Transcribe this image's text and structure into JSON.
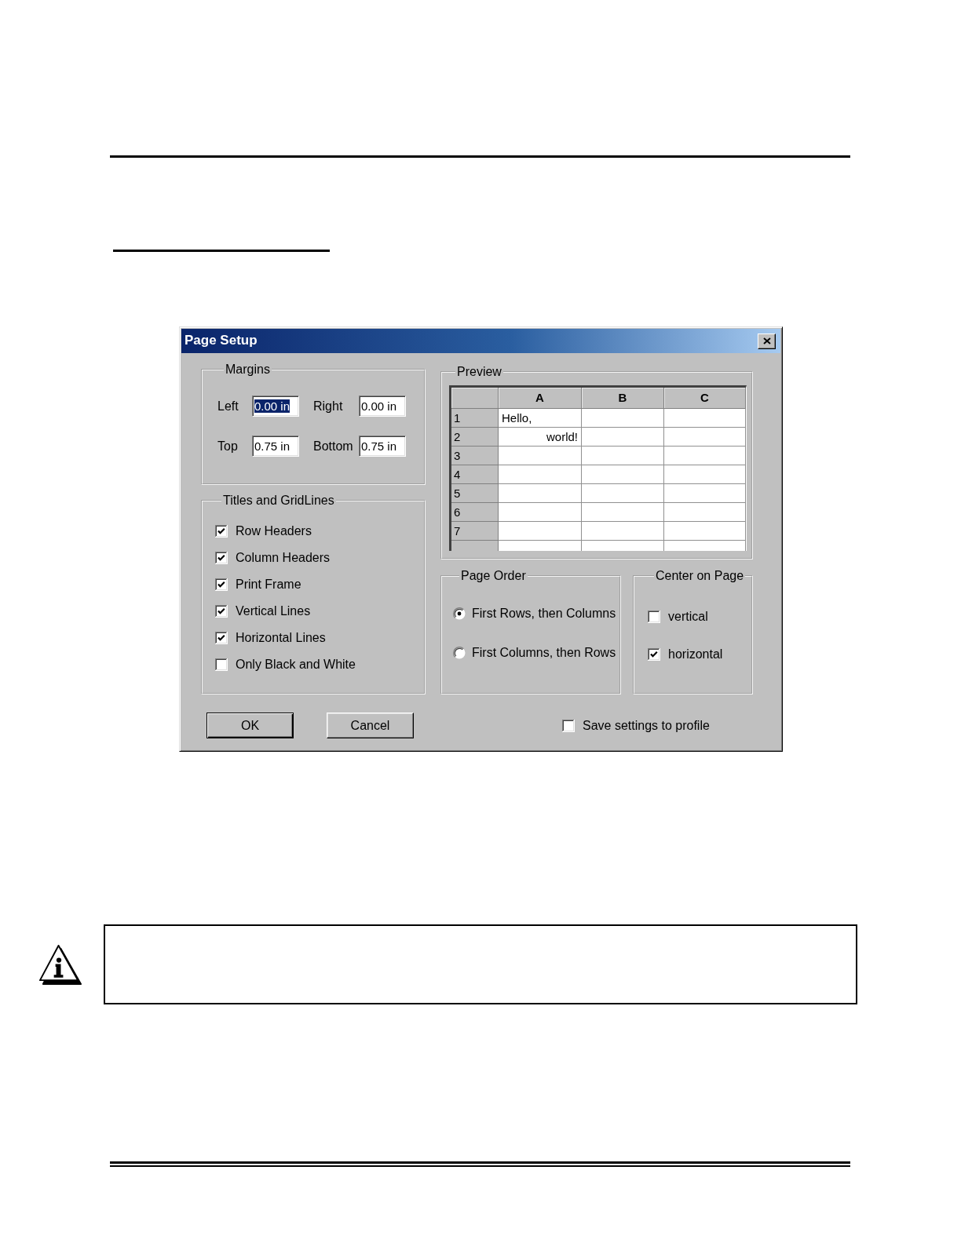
{
  "dialog": {
    "title": "Page Setup",
    "margins": {
      "title": "Margins",
      "fields": [
        {
          "label": "Left",
          "value": "0.00 in",
          "selected": true
        },
        {
          "label": "Right",
          "value": "0.00 in",
          "selected": false
        },
        {
          "label": "Top",
          "value": "0.75 in",
          "selected": false
        },
        {
          "label": "Bottom",
          "value": "0.75 in",
          "selected": false
        }
      ]
    },
    "titles_and_gridlines": {
      "title": "Titles and GridLines",
      "options": [
        {
          "label": "Row Headers",
          "checked": true
        },
        {
          "label": "Column Headers",
          "checked": true
        },
        {
          "label": "Print Frame",
          "checked": true
        },
        {
          "label": "Vertical Lines",
          "checked": true
        },
        {
          "label": "Horizontal Lines",
          "checked": true
        },
        {
          "label": "Only Black and White",
          "checked": false
        }
      ]
    },
    "preview": {
      "title": "Preview",
      "columns": [
        "A",
        "B",
        "C"
      ],
      "rows": [
        {
          "header": "1",
          "cells": [
            {
              "text": "Hello,",
              "right_aligned": false
            }
          ]
        },
        {
          "header": "2",
          "cells": [
            {
              "text": "world!",
              "right_aligned": true
            }
          ]
        },
        {
          "header": "3"
        },
        {
          "header": "4"
        },
        {
          "header": "5"
        },
        {
          "header": "6"
        },
        {
          "header": "7"
        }
      ]
    },
    "page_order": {
      "title": "Page Order",
      "options": [
        {
          "label": "First Rows, then Columns",
          "selected": true
        },
        {
          "label": "First Columns, then Rows",
          "selected": false
        }
      ]
    },
    "center_on_page": {
      "title": "Center on Page",
      "options": [
        {
          "label": "vertical",
          "checked": false
        },
        {
          "label": "horizontal",
          "checked": true
        }
      ]
    },
    "buttons": [
      {
        "label": "OK",
        "default": true
      },
      {
        "label": "Cancel",
        "default": false
      }
    ],
    "save_to_profile": {
      "label": "Save settings to profile",
      "checked": false
    }
  }
}
